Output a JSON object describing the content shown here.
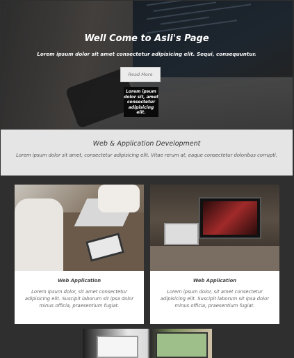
{
  "hero": {
    "title": "Well Come to Asli's Page",
    "subtitle": "Lorem ipsum dolor sit amet consectetur adipisicing elit. Sequi, consequuntur.",
    "button_label": "Read More",
    "tooltip": "Lorem ipsum dolor sit, amet consectetur adipisicing elit."
  },
  "section": {
    "title": "Web & Application Development",
    "text": "Lorem ipsum dolor sit amet, consectetur adipisicing elit. Vitae rerum at, eaque consectetur doloribus corrupti."
  },
  "cards": [
    {
      "title": "Web Application",
      "text": "Lorem ipsum dolor, sit amet consectetur adipisicing elit. Suscipit laborum sit ipsa dolor minus officia, praesentium fugiat."
    },
    {
      "title": "Web Application",
      "text": "Lorem ipsum dolor, sit amet consectetur adipisicing elit. Suscipit laborum sit ipsa dolor minus officia, praesentium fugiat."
    }
  ],
  "colors": {
    "page_background": "#2f2f2f",
    "section_background": "#e5e5e5",
    "button_background": "#ececec",
    "tooltip_background": "#0a0a0a"
  }
}
